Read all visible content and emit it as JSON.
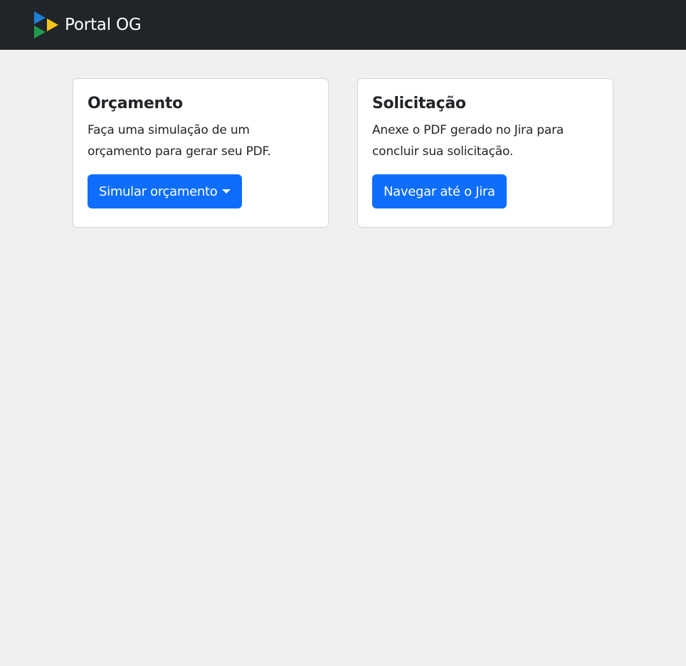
{
  "navbar": {
    "brand_text": "Portal OG",
    "logo_icon": "triangle-play-logo",
    "logo_colors": [
      "#1d7fd6",
      "#f5c518",
      "#1e9e4a"
    ]
  },
  "cards": [
    {
      "title": "Orçamento",
      "text": "Faça uma simulação de um orçamento para gerar seu PDF.",
      "button_label": "Simular orçamento",
      "button_icon": "caret-down-icon"
    },
    {
      "title": "Solicitação",
      "text": "Anexe o PDF gerado no Jira para concluir sua solicitação.",
      "button_label": "Navegar até o Jira"
    }
  ],
  "colors": {
    "navbar_bg": "#212529",
    "page_bg": "#f0f0f0",
    "primary": "#0d6efd"
  }
}
